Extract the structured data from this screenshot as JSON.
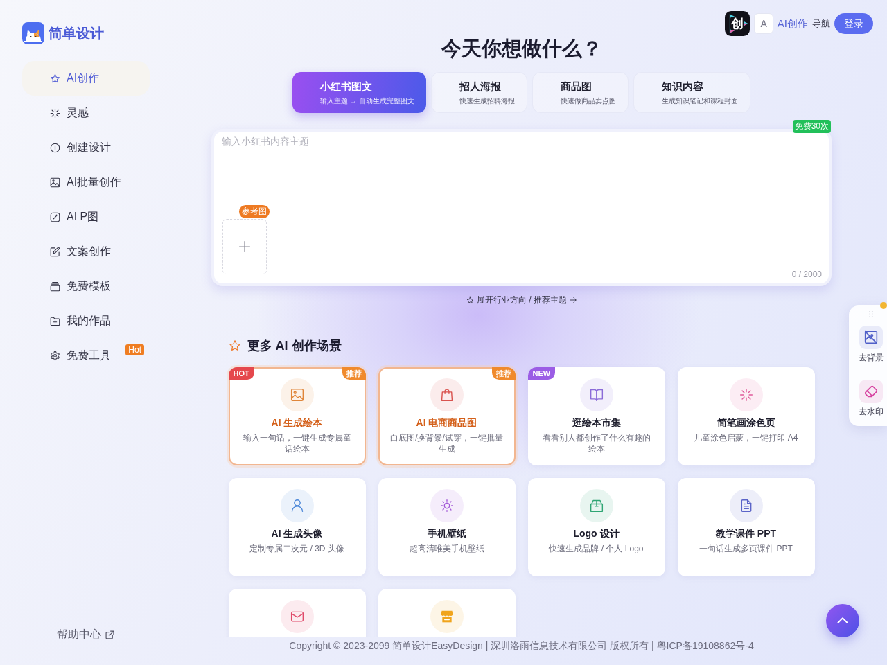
{
  "sidebar": {
    "brand": "简单设计",
    "items": [
      {
        "label": "AI创作",
        "selected": true
      },
      {
        "label": "灵感",
        "selected": false
      },
      {
        "label": "创建设计",
        "selected": false
      },
      {
        "label": "AI批量创作",
        "selected": false
      },
      {
        "label": "AI P图",
        "selected": false
      },
      {
        "label": "文案创作",
        "selected": false
      },
      {
        "label": "免费模板",
        "selected": false
      },
      {
        "label": "我的作品",
        "selected": false
      },
      {
        "label": "免费工具",
        "selected": false,
        "badge": "Hot"
      }
    ],
    "help": "帮助中心"
  },
  "topbar": {
    "logo_glyph": "创",
    "field_value": "A",
    "app_name": "AI创作",
    "nav_label": "导航",
    "login_label": "登录"
  },
  "heading": "今天你想做什么？",
  "modes": [
    {
      "title": "小红书图文",
      "subtitle": "输入主题 → 自动生成完整图文",
      "selected": true
    },
    {
      "title": "招人海报",
      "subtitle": "快速生成招聘海报",
      "selected": false
    },
    {
      "title": "商品图",
      "subtitle": "快速做商品卖点图",
      "selected": false
    },
    {
      "title": "知识内容",
      "subtitle": "生成知识笔记和课程封面",
      "selected": false
    }
  ],
  "prompt": {
    "placeholder": "输入小红书内容主题",
    "quota_badge": "免费30次",
    "reference_label": "参考图",
    "counter": "0 / 2000"
  },
  "expand_link": "展开行业方向 / 推荐主题",
  "scenes": {
    "title": "更多 AI 创作场景",
    "cards": [
      {
        "title": "AI 生成绘本",
        "description": "输入一句话，一键生成专属童话绘本",
        "highlighted": true,
        "color": "#e0863a",
        "badge_left": {
          "text": "HOT",
          "color": "#e5484d"
        },
        "badge_right": {
          "text": "推荐",
          "color": "#f08a2c"
        }
      },
      {
        "title": "AI 电商商品图",
        "description": "白底图/换背景/试穿，一键批量生成",
        "highlighted": true,
        "color": "#d9534f",
        "badge_right": {
          "text": "推荐",
          "color": "#f08a2c"
        }
      },
      {
        "title": "逛绘本市集",
        "description": "看看别人都创作了什么有趣的绘本",
        "highlighted": false,
        "color": "#8b6bd8",
        "badge_left": {
          "text": "NEW",
          "color": "#9b5de5"
        }
      },
      {
        "title": "简笔画涂色页",
        "description": "儿童涂色启蒙，一键打印 A4",
        "highlighted": false,
        "color": "#e05a9a"
      },
      {
        "title": "AI 生成头像",
        "description": "定制专属二次元 / 3D 头像",
        "highlighted": false,
        "color": "#4a86d8"
      },
      {
        "title": "手机壁纸",
        "description": "超高清唯美手机壁纸",
        "highlighted": false,
        "color": "#a35bd8"
      },
      {
        "title": "Logo 设计",
        "description": "快速生成品牌 / 个人 Logo",
        "highlighted": false,
        "color": "#2fa574"
      },
      {
        "title": "教学课件 PPT",
        "description": "一句话生成多页课件 PPT",
        "highlighted": false,
        "color": "#5b64c8"
      },
      {
        "highlighted": false,
        "color": "#e04a6a"
      },
      {
        "highlighted": false,
        "color": "#f0a41c"
      }
    ]
  },
  "side_tools": [
    {
      "label": "去背景",
      "color": "#4f5fc8"
    },
    {
      "label": "去水印",
      "color": "#d6409f"
    }
  ],
  "footer": {
    "copyright": "Copyright © 2023-2099 简单设计EasyDesign | 深圳洛雨信息技术有限公司 版权所有 |",
    "icp": "粤ICP备19108862号-4"
  }
}
